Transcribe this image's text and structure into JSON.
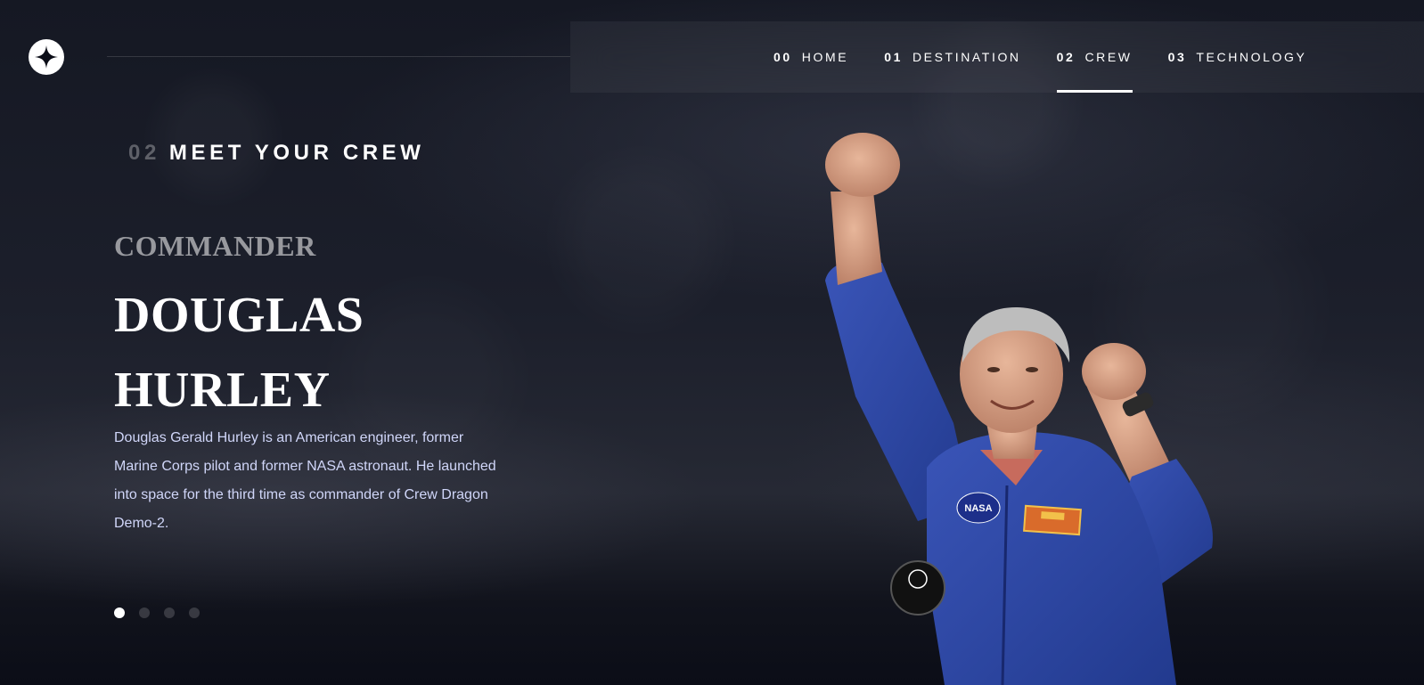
{
  "nav": {
    "items": [
      {
        "num": "00",
        "label": "HOME"
      },
      {
        "num": "01",
        "label": "DESTINATION"
      },
      {
        "num": "02",
        "label": "CREW"
      },
      {
        "num": "03",
        "label": "TECHNOLOGY"
      }
    ],
    "active_index": 2
  },
  "page": {
    "subheading_num": "02",
    "subheading_text": "MEET YOUR CREW"
  },
  "crew": {
    "role": "Commander",
    "name_line1": "Douglas",
    "name_line2": "Hurley",
    "bio": "Douglas Gerald Hurley is an American engineer, former Marine Corps pilot and former NASA astronaut. He launched into space for the third time as commander of Crew Dragon Demo-2.",
    "image_icon": "astronaut-photo",
    "patch_text": "NASA"
  },
  "carousel": {
    "count": 4,
    "active_index": 0
  },
  "colors": {
    "background": "#0b0d17",
    "text_light": "#d0d6f9",
    "white": "#ffffff",
    "suit_blue": "#2f45a0"
  }
}
